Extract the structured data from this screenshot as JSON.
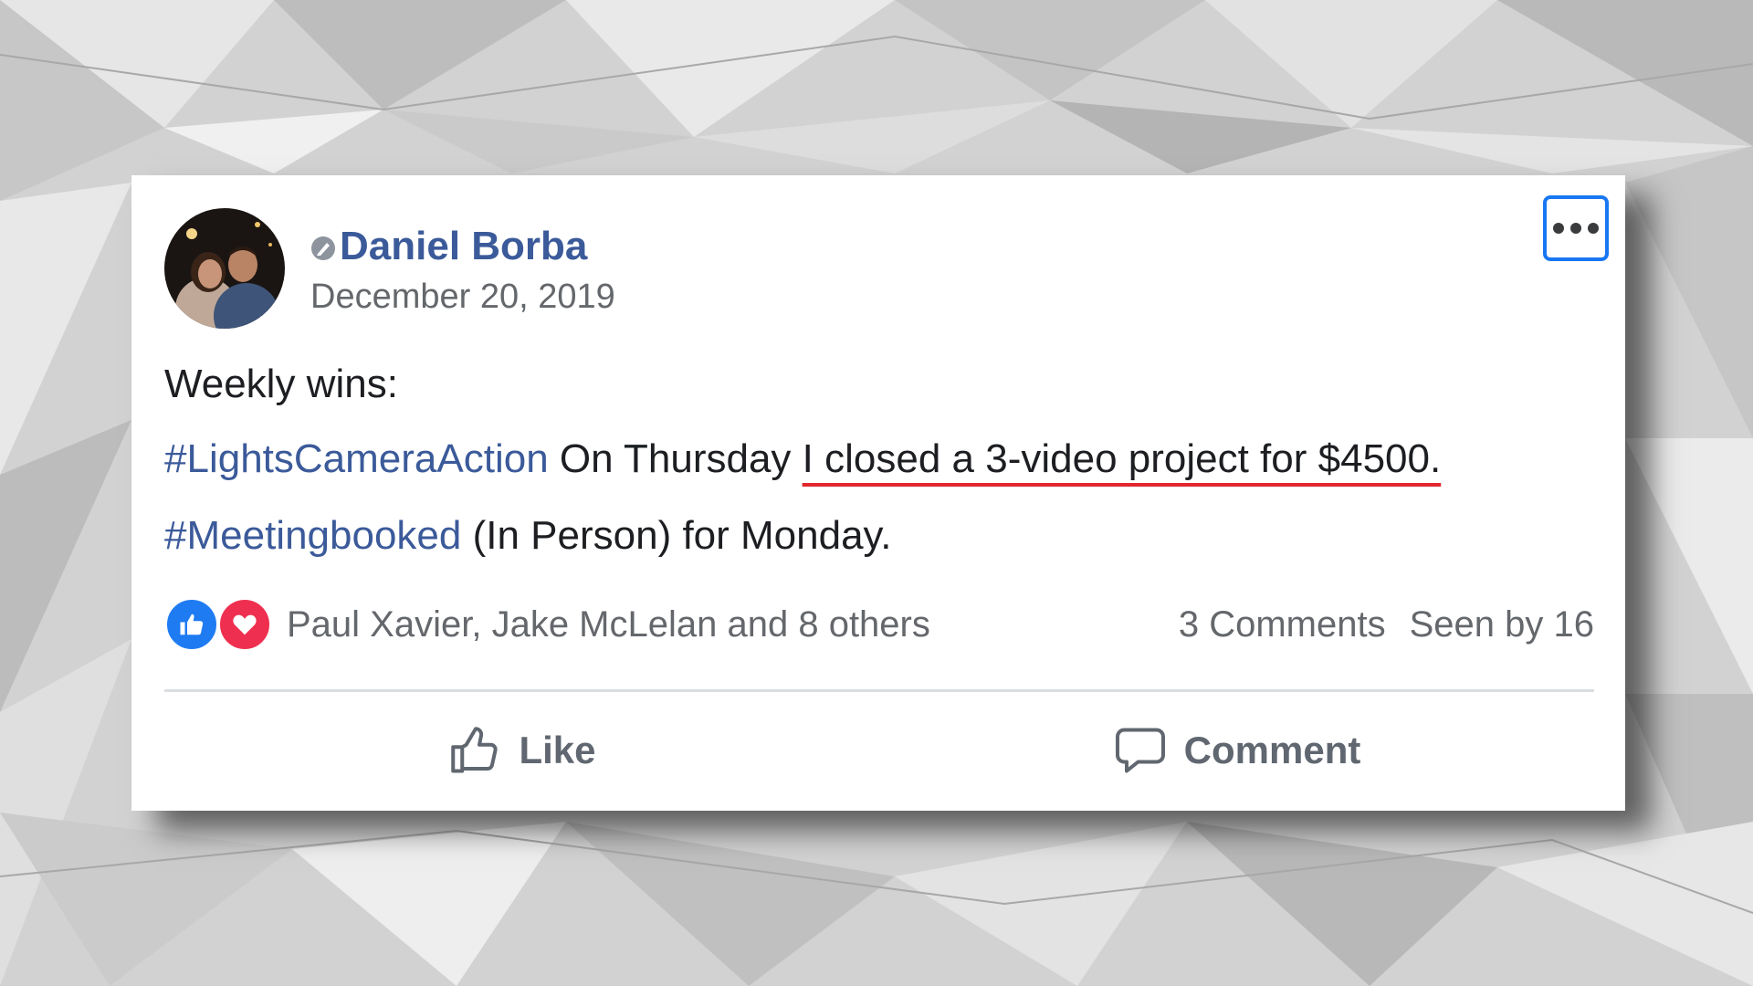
{
  "post": {
    "author": "Daniel Borba",
    "date": "December 20, 2019",
    "content": {
      "line1": "Weekly wins:",
      "line2": {
        "hashtag": "#LightsCameraAction",
        "text_plain": " On Thursday ",
        "text_underlined": "I closed a 3-video project for $4500."
      },
      "line3": {
        "hashtag": "#Meetingbooked",
        "text": " (In Person) for Monday."
      }
    },
    "reactions": {
      "types": [
        "like-icon",
        "love-icon"
      ],
      "reactors_text": "Paul Xavier, Jake McLelan and 8 others",
      "comments_text": "3 Comments",
      "seen_text": "Seen by 16"
    },
    "actions": {
      "like_label": "Like",
      "comment_label": "Comment"
    }
  },
  "colors": {
    "author_link": "#3b5a9a",
    "hashtag": "#3b5a9a",
    "highlight_underline": "#e3262d",
    "focus_outline": "#1877f2",
    "like_reaction": "#1f7bf2",
    "love_reaction": "#ef2f4f"
  }
}
